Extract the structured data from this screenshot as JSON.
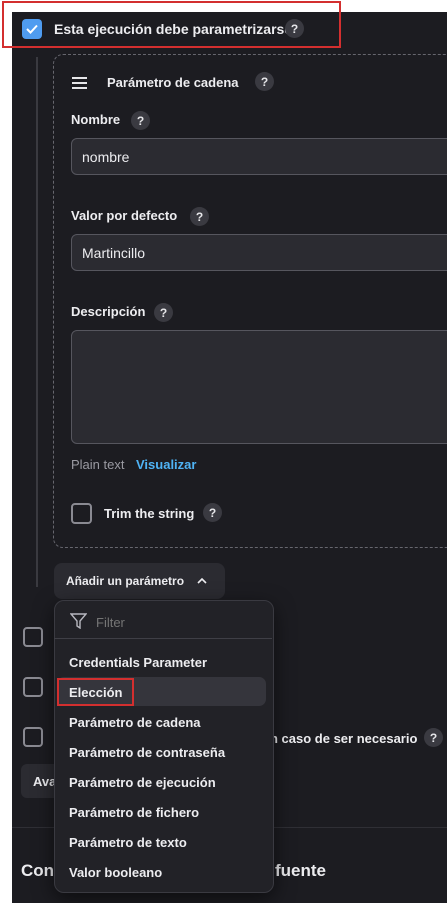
{
  "parametrize": {
    "label": "Esta ejecución debe parametrizarse",
    "help": "?",
    "checked": true,
    "check_color": "#4f9cf0"
  },
  "string_param": {
    "title": "Parámetro de cadena",
    "help": "?",
    "name_label": "Nombre",
    "name_value": "nombre",
    "default_label": "Valor por defecto",
    "default_value": "Martincillo",
    "description_label": "Descripción",
    "description_value": "",
    "format_text": "Plain text",
    "preview_link": "Visualizar",
    "trim_label": "Trim the string",
    "trim_checked": false
  },
  "add_param_button": {
    "label": "Añadir un parámetro"
  },
  "dropdown": {
    "filter_placeholder": "Filter",
    "items": [
      "Credentials Parameter",
      "Elección",
      "Parámetro de cadena",
      "Parámetro de contraseña",
      "Parámetro de ejecución",
      "Parámetro de fichero",
      "Parámetro de texto",
      "Valor booleano"
    ],
    "highlighted_index": 1
  },
  "behind": {
    "option_text_fragment": "n caso de ser necesario",
    "help": "?",
    "advanced_button_fragment": "Ava",
    "section_title_left": "Con",
    "section_title_right": "fuente"
  },
  "colors": {
    "accent": "#4f9cf0",
    "link": "#4fb3f5",
    "highlight_box": "#d32f2f"
  }
}
